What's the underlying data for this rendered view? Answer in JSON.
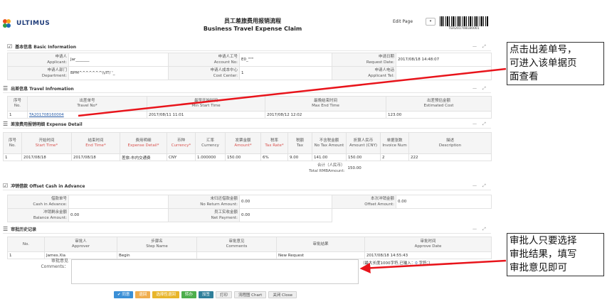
{
  "header": {
    "logo_text": "ULTIMUS",
    "title_cn": "员工差旅费用报销流程",
    "title_en": "Business Travel Expense Claim",
    "edit_page_label": "Edit Page",
    "dropdown_glyph": "▾",
    "barcode_text": "TER201708180001"
  },
  "basic": {
    "icon": "☑",
    "title": "基本信息 Basic Information",
    "applicant_label_cn": "申请人",
    "applicant_label_en": "Applicant:",
    "applicant_value": "Jar_______",
    "account_label_cn": "申请人工号",
    "account_label_en": "Account No:",
    "account_value": "E0_\"\"\"",
    "request_date_label_cn": "申请日期",
    "request_date_label_en": "Request Date:",
    "request_date_value": "2017/08/18 14:48:07",
    "dept_label_cn": "申请人部门",
    "dept_label_en": "Department:",
    "dept_value": "BPM^^^^^^^\\\\/IT/ '_",
    "cost_center_label_cn": "申请人成本中心",
    "cost_center_label_en": "Cost Center:",
    "cost_center_value": "1",
    "tel_label_cn": "申请人电话",
    "tel_label_en": "Applicant Tel:",
    "tel_value": ""
  },
  "travel": {
    "icon": "☰",
    "title": "出差信息 Travel Infromation",
    "headers": [
      {
        "cn": "序号",
        "en": "No."
      },
      {
        "cn": "出差单号",
        "en": "Travel No*"
      },
      {
        "cn": "最早开始时间",
        "en": "Min Start Time"
      },
      {
        "cn": "最晚结束时间",
        "en": "Max End Time"
      },
      {
        "cn": "出差预估金额",
        "en": "Estimated Cost"
      }
    ],
    "rows": [
      {
        "no": "1",
        "travel_no": "TA201708160004",
        "start": "2017/08/11 11:01",
        "end": "2017/08/12 12:02",
        "cost": "123.00"
      }
    ]
  },
  "expense": {
    "icon": "☰",
    "title": "差旅费用报销明细 Expense Detail",
    "headers": [
      {
        "cn": "序号",
        "en": "No."
      },
      {
        "cn": "开始时间",
        "en": "Start Time*"
      },
      {
        "cn": "结束时间",
        "en": "End Time*"
      },
      {
        "cn": "费用明细",
        "en": "Expense Detail*"
      },
      {
        "cn": "币种",
        "en": "Currency*"
      },
      {
        "cn": "汇率",
        "en": "Currency"
      },
      {
        "cn": "发票金额",
        "en": "Amount*"
      },
      {
        "cn": "税率",
        "en": "Tax Rate*"
      },
      {
        "cn": "税额",
        "en": "Tax"
      },
      {
        "cn": "不含税金额",
        "en": "No Tax Amount"
      },
      {
        "cn": "折算人民币",
        "en": "Amount (CNY)"
      },
      {
        "cn": "单据张数",
        "en": "Invoice Num"
      },
      {
        "cn": "描述",
        "en": "Description"
      }
    ],
    "rows": [
      [
        "1",
        "2017/08/18",
        "2017/08/18",
        "差旅-市内交通费",
        "CNY",
        "1.000000",
        "150.00",
        "6%",
        "9.00",
        "141.00",
        "150.00",
        "2",
        "222"
      ]
    ],
    "total_label_cn": "合计（人民币）",
    "total_label_en": "Total RMBAmount:",
    "total_value": "150.00"
  },
  "offset": {
    "icon": "☑",
    "title": "冲销借款 Offset Cash in Advance",
    "cash_adv_cn": "借款单号",
    "cash_adv_en": "Cash in Advance:",
    "cash_adv_value": "",
    "no_return_cn": "未归还借款金额",
    "no_return_en": "No Return Amount:",
    "no_return_value": "0.00",
    "offset_amt_cn": "本次冲销金额",
    "offset_amt_en": "Offset Amount:",
    "offset_amt_value": "0.00",
    "balance_cn": "冲销剩余金额",
    "balance_en": "Balance Amount:",
    "balance_value": "0.00",
    "net_pay_cn": "员工实收金额",
    "net_pay_en": "Net Payment:",
    "net_pay_value": "0.00"
  },
  "approval": {
    "icon": "☰",
    "title": "审批历史记录",
    "headers": [
      {
        "cn": "",
        "en": "No."
      },
      {
        "cn": "审批人",
        "en": "Approver"
      },
      {
        "cn": "步骤名",
        "en": "Step Name"
      },
      {
        "cn": "审批意见",
        "en": "Comments"
      },
      {
        "cn": "审批结果",
        "en": ""
      },
      {
        "cn": "审批时间",
        "en": "Approve Date"
      }
    ],
    "rows": [
      {
        "no": "1",
        "approver": "James.Xia",
        "step": "Begin",
        "comments": "",
        "result": "New Request",
        "date": "2017/08/18 14:55:43"
      }
    ],
    "comment_label_cn": "审批意见",
    "comment_label_en": "Comments：",
    "char_hint_pre": "（最大长度1000字符,已输入：",
    "char_hint_count": "0",
    "char_hint_post": " 字符；）"
  },
  "buttons": {
    "approve": "✔ 同意",
    "reject": "退回",
    "select_reject": "选择性退回",
    "forward": "转办",
    "sign": "加签",
    "print": "打印",
    "chart": "流程图 Chart",
    "close": "关闭 Close"
  },
  "window_controls": {
    "minimize": "—",
    "expand": "⤢"
  },
  "annotations": {
    "top": [
      "点击出差单号，",
      "可进入该单据页",
      "面查看"
    ],
    "bottom": [
      "审批人只要选择",
      "审批结果，填写",
      "审批意见即可"
    ],
    "arrow_color": "#e8141b"
  }
}
